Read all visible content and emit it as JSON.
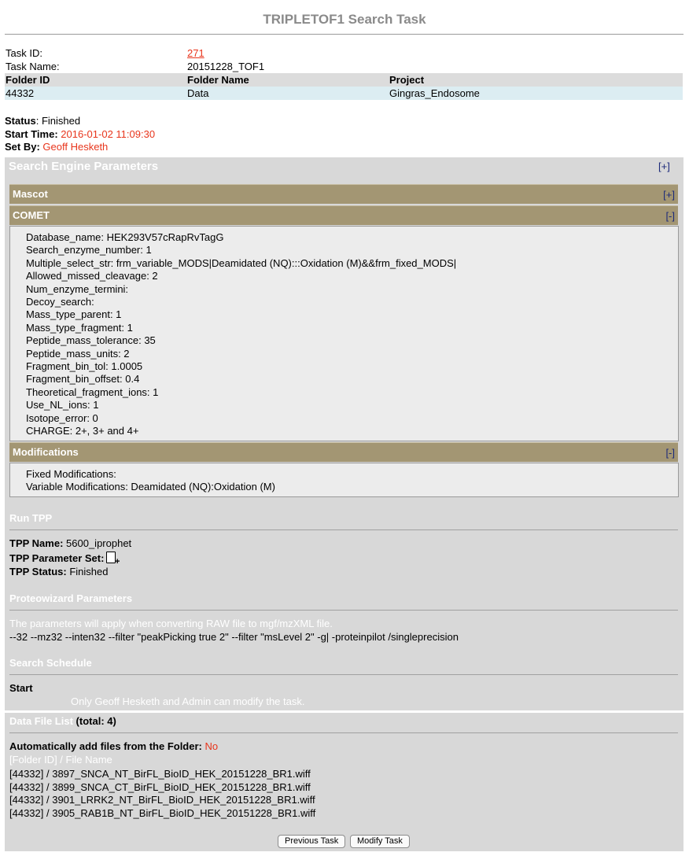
{
  "page": {
    "title": "TRIPLETOF1 Search Task"
  },
  "task": {
    "id_label": "Task ID:",
    "id_value": "271",
    "name_label": "Task Name:",
    "name_value": "20151228_TOF1"
  },
  "folder_table": {
    "headers": [
      "Folder ID",
      "Folder Name",
      "Project"
    ],
    "row": [
      "44332",
      "Data",
      "Gingras_Endosome"
    ]
  },
  "status": {
    "status_label": "Status",
    "status_value": "Finished",
    "start_label": "Start Time:",
    "start_value": "2016-01-02 11:09:30",
    "setby_label": "Set By:",
    "setby_value": "Geoff Hesketh"
  },
  "search_engine": {
    "title": "Search Engine Parameters",
    "toggle": "[+]",
    "mascot": {
      "label": "Mascot",
      "toggle": "[+]"
    },
    "comet": {
      "label": "COMET",
      "toggle": "[-]",
      "lines": [
        "Database_name: HEK293V57cRapRvTagG",
        "Search_enzyme_number: 1",
        "Multiple_select_str: frm_variable_MODS|Deamidated (NQ):::Oxidation (M)&&frm_fixed_MODS|",
        "Allowed_missed_cleavage: 2",
        "Num_enzyme_termini:",
        "Decoy_search:",
        "Mass_type_parent: 1",
        "Mass_type_fragment: 1",
        "Peptide_mass_tolerance: 35",
        "Peptide_mass_units: 2",
        "Fragment_bin_tol: 1.0005",
        "Fragment_bin_offset: 0.4",
        "Theoretical_fragment_ions: 1",
        "Use_NL_ions: 1",
        "Isotope_error: 0",
        "CHARGE: 2+, 3+ and 4+"
      ]
    },
    "modifications": {
      "label": "Modifications",
      "toggle": "[-]",
      "fixed": "Fixed Modifications:",
      "variable": "Variable Modifications: Deamidated (NQ):Oxidation (M)"
    }
  },
  "run_tpp": {
    "title": "Run TPP",
    "name_label": "TPP Name:",
    "name_value": "5600_iprophet",
    "param_label": "TPP Parameter Set:",
    "param_icon": "add-document-icon",
    "status_label": "TPP Status:",
    "status_value": "Finished"
  },
  "proteowizard": {
    "title": "Proteowizard Parameters",
    "note": "The parameters will apply when converting RAW file to mgf/mzXML file.",
    "params": "--32 --mz32 --inten32 --filter \"peakPicking true 2\" --filter \"msLevel 2\" -g| -proteinpilot /singleprecision"
  },
  "schedule": {
    "title": "Search Schedule",
    "start": "Start",
    "note": "Only Geoff Hesketh and Admin can modify the task."
  },
  "data_files": {
    "title": "Data File List",
    "total": "(total: 4)",
    "auto_label": "Automatically add files from the Folder:",
    "auto_value": "No",
    "column_header": "[Folder ID] / File Name",
    "files": [
      "[44332] / 3897_SNCA_NT_BirFL_BioID_HEK_20151228_BR1.wiff",
      "[44332] / 3899_SNCA_CT_BirFL_BioID_HEK_20151228_BR1.wiff",
      "[44332] / 3901_LRRK2_NT_BirFL_BioID_HEK_20151228_BR1.wiff",
      "[44332] / 3905_RAB1B_NT_BirFL_BioID_HEK_20151228_BR1.wiff"
    ]
  },
  "buttons": {
    "previous": "Previous Task",
    "modify": "Modify Task"
  },
  "colors": {
    "accent_red": "#e8351c",
    "section_bar": "#a39673",
    "panel_bg": "#d8d8d8",
    "folder_row_bg": "#dcedf2"
  }
}
